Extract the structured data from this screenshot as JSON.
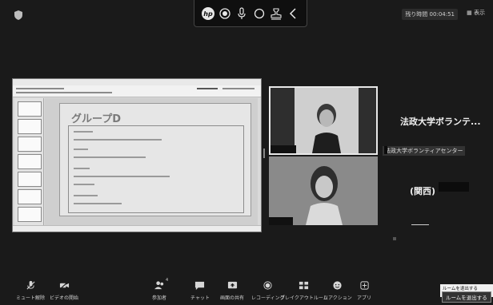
{
  "top": {
    "timer_label": "残り時間",
    "timer_value": "00:04:51",
    "view_label": "表示"
  },
  "floatbar": {
    "icons": [
      "hp-logo",
      "record-icon",
      "microphone-icon",
      "circle-icon",
      "stamp-icon",
      "back-icon"
    ]
  },
  "share": {
    "slide_title": "グループD"
  },
  "participants": [
    {
      "name": "法政大学ボランテ...",
      "subname": "法政大学ボランティアセンター"
    },
    {
      "name": "(関西)"
    }
  ],
  "toolbar": {
    "items": [
      {
        "icon": "mic-muted-icon",
        "label": "ミュート解除"
      },
      {
        "icon": "video-off-icon",
        "label": "ビデオの開始"
      },
      {
        "icon": "participants-icon",
        "label": "参加者",
        "badge": "4"
      },
      {
        "icon": "chat-icon",
        "label": "チャット"
      },
      {
        "icon": "share-screen-icon",
        "label": "画面の共有"
      },
      {
        "icon": "record-icon",
        "label": "レコーディング"
      },
      {
        "icon": "breakout-icon",
        "label": "ブレイクアウトルーム"
      },
      {
        "icon": "reaction-icon",
        "label": "リアクション"
      },
      {
        "icon": "apps-icon",
        "label": "アプリ"
      }
    ],
    "leave_hint": "ルームを退出する (Alt+Q)",
    "leave_label": "ルームを退出する"
  },
  "colors": {
    "background": "#1a1a1a",
    "tile_border": "#e8e8e8"
  }
}
